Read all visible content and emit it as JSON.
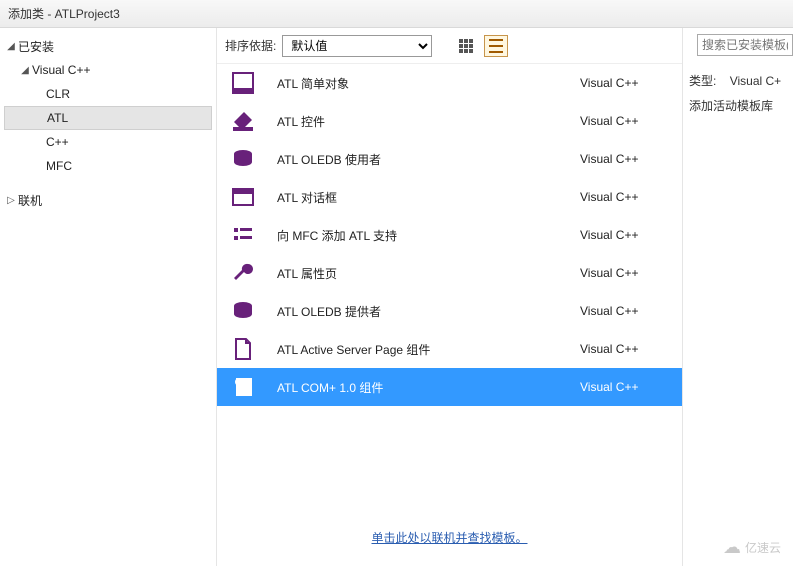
{
  "titlebar": "添加类 - ATLProject3",
  "sidebar": {
    "installed": "已安装",
    "vc": "Visual C++",
    "items": {
      "clr": "CLR",
      "atl": "ATL",
      "cpp": "C++",
      "mfc": "MFC"
    },
    "online": "联机"
  },
  "toolbar": {
    "sort_label": "排序依据:",
    "sort_value": "默认值"
  },
  "search": {
    "placeholder": "搜索已安装模板(Ct"
  },
  "templates": [
    {
      "name": "ATL 简单对象",
      "lang": "Visual C++",
      "selected": false
    },
    {
      "name": "ATL 控件",
      "lang": "Visual C++",
      "selected": false
    },
    {
      "name": "ATL OLEDB 使用者",
      "lang": "Visual C++",
      "selected": false
    },
    {
      "name": "ATL 对话框",
      "lang": "Visual C++",
      "selected": false
    },
    {
      "name": "向 MFC 添加 ATL 支持",
      "lang": "Visual C++",
      "selected": false
    },
    {
      "name": "ATL 属性页",
      "lang": "Visual C++",
      "selected": false
    },
    {
      "name": "ATL OLEDB 提供者",
      "lang": "Visual C++",
      "selected": false
    },
    {
      "name": "ATL Active Server Page 组件",
      "lang": "Visual C++",
      "selected": false
    },
    {
      "name": "ATL COM+ 1.0 组件",
      "lang": "Visual C++",
      "selected": true
    }
  ],
  "footer_link": "单击此处以联机并查找模板。",
  "details": {
    "type_label": "类型:",
    "type_value": "Visual C+",
    "description": "添加活动模板库"
  },
  "watermark": "亿速云"
}
